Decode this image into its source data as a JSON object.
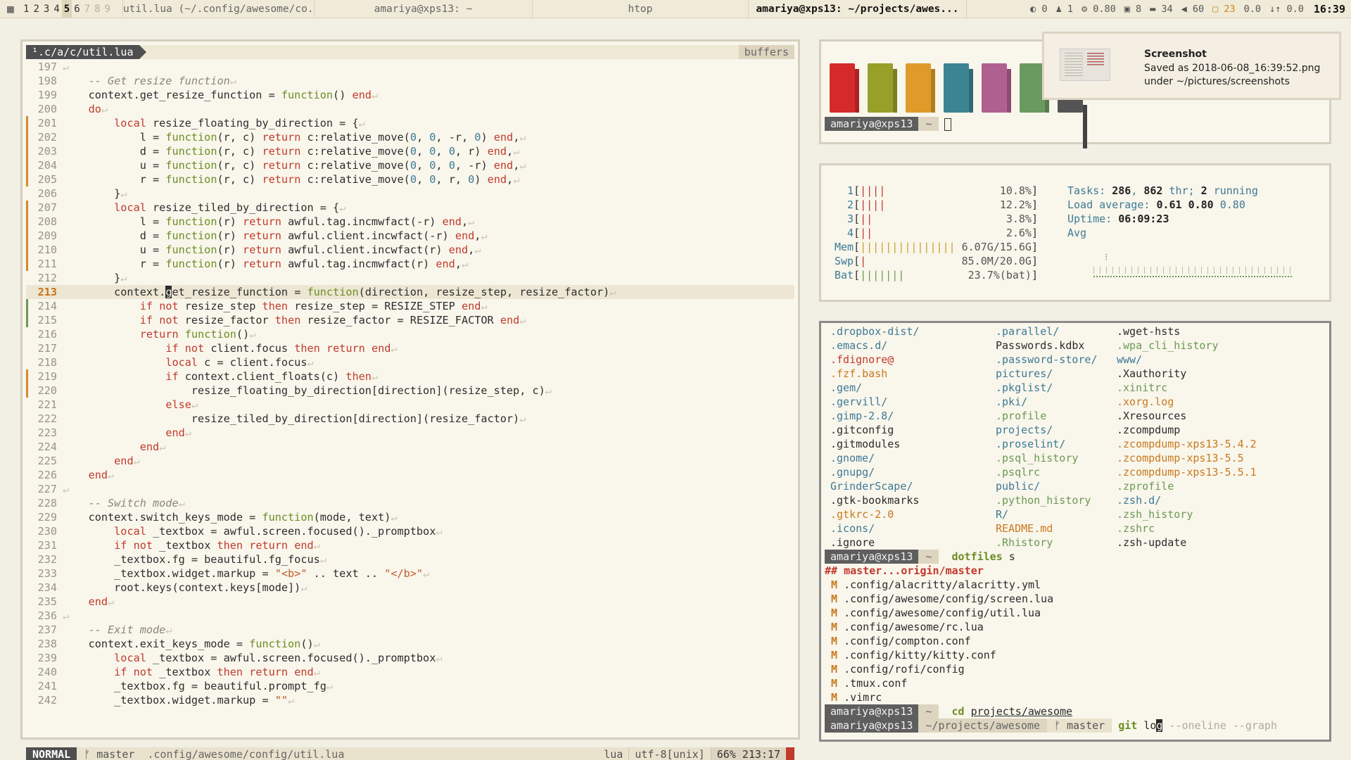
{
  "topbar": {
    "tags": [
      {
        "label": "1",
        "state": "occupied"
      },
      {
        "label": "2",
        "state": "occupied"
      },
      {
        "label": "3",
        "state": "occupied"
      },
      {
        "label": "4",
        "state": "occupied"
      },
      {
        "label": "5",
        "state": "selected"
      },
      {
        "label": "6",
        "state": "occupied"
      },
      {
        "label": "7",
        "state": "empty"
      },
      {
        "label": "8",
        "state": "empty"
      },
      {
        "label": "9",
        "state": "empty"
      }
    ],
    "tasks": [
      {
        "label": "util.lua (~/.config/awesome/co...",
        "focused": false
      },
      {
        "label": "amariya@xps13: ~",
        "focused": false
      },
      {
        "label": "htop",
        "focused": false
      },
      {
        "label": "amariya@xps13: ~/projects/awes...",
        "focused": true
      }
    ],
    "widgets": {
      "w1": "◐ 0",
      "w2": "♟ 1",
      "w3": "⚙ 0.80",
      "w4": "▣ 8",
      "w5": "▬ 34",
      "w6": "◀ 60",
      "w7": "▢ 23",
      "w8": "0.0",
      "w9": "↓↑ 0.0"
    },
    "clock": "16:39"
  },
  "vim": {
    "file_tab": "¹.c/a/c/util.lua",
    "buffers_label": "buffers",
    "status": {
      "mode": "NORMAL",
      "branch": "ᚠ master",
      "path": ".config/awesome/config/util.lua",
      "filetype": "lua",
      "encoding": "utf-8[unix]",
      "position": "66% 213:17"
    }
  },
  "colors_term": {
    "swatches": [
      "#d42a2a",
      "#98a02a",
      "#de9b2a",
      "#3d8493",
      "#b06090",
      "#6b9a60",
      "#545454"
    ],
    "prompt_user": "amariya@xps13",
    "prompt_dir": "~"
  },
  "notification": {
    "title": "Screenshot",
    "body": "Saved as 2018-06-08_16:39:52.png\nunder ~/pictures/screenshots"
  },
  "htop": {
    "cpus": [
      {
        "label": "1",
        "bars": "||||",
        "value": "10.8%"
      },
      {
        "label": "2",
        "bars": "||||",
        "value": "12.2%"
      },
      {
        "label": "3",
        "bars": "||",
        "value": "3.8%"
      },
      {
        "label": "4",
        "bars": "||",
        "value": "2.6%"
      }
    ],
    "mem": {
      "label": "Mem",
      "bars": "|||||||||||||||",
      "value": "6.07G/15.6G"
    },
    "swp": {
      "label": "Swp",
      "bars": "|",
      "value": "85.0M/20.0G"
    },
    "bat": {
      "label": "Bat",
      "bars": "|||||||",
      "value": "23.7%(bat)"
    },
    "tasks_label": "Tasks: ",
    "tasks_count": "286",
    "threads": "862",
    "thr_label": " thr; ",
    "running": "2",
    "running_label": " running",
    "load_label": "Load average: ",
    "load1": "0.61",
    "load5": "0.80",
    "load15": "0.80",
    "uptime_label": "Uptime: ",
    "uptime": "06:09:23",
    "avg_label": "Avg"
  },
  "terminal": {
    "ls_col1": [
      ".dropbox-dist/",
      ".emacs.d/",
      ".fdignore@",
      ".fzf.bash",
      ".gem/",
      ".gervill/",
      ".gimp-2.8/",
      ".gitconfig",
      ".gitmodules",
      ".gnome/",
      ".gnupg/",
      "GrinderScape/",
      ".gtk-bookmarks",
      ".gtkrc-2.0",
      ".icons/",
      ".ignore"
    ],
    "ls_col2": [
      ".parallel/",
      "Passwords.kdbx",
      ".password-store/",
      "pictures/",
      ".pkglist/",
      ".pki/",
      ".profile",
      "projects/",
      ".proselint/",
      ".psql_history",
      ".psqlrc",
      "public/",
      ".python_history",
      "R/",
      "README.md",
      ".Rhistory"
    ],
    "ls_col3": [
      ".wget-hsts",
      ".wpa_cli_history",
      "www/",
      ".Xauthority",
      ".xinitrc",
      ".xorg.log",
      ".Xresources",
      ".zcompdump",
      ".zcompdump-xps13-5.4.2",
      ".zcompdump-xps13-5.5",
      ".zcompdump-xps13-5.5.1",
      ".zprofile",
      ".zsh.d/",
      ".zsh_history",
      ".zshrc",
      ".zsh-update"
    ],
    "prompt_user": "amariya@xps13",
    "prompt_home": "~",
    "cmd1": "dotfiles",
    "cmd1_arg": "s",
    "git_branch_line": "master...origin/master",
    "git_hash": "##",
    "modified_flag": "M",
    "modified_files": [
      ".config/alacritty/alacritty.yml",
      ".config/awesome/config/screen.lua",
      ".config/awesome/config/util.lua",
      ".config/awesome/rc.lua",
      ".config/compton.conf",
      ".config/kitty/kitty.conf",
      ".config/rofi/config",
      ".tmux.conf",
      ".vimrc"
    ],
    "cmd2": "cd",
    "cmd2_arg": "projects/awesome",
    "prompt_dir2": "~/projects/awesome",
    "prompt_branch2": "ᚠ master",
    "cmd3": "git",
    "cmd3_typed": "lo",
    "cmd3_cursor": "g",
    "cmd3_suggest": "--oneline --graph"
  },
  "code_lines": [
    {
      "n": "197",
      "g": "",
      "t": ""
    },
    {
      "n": "198",
      "g": "",
      "t": "    <span class='cm'>-- Get resize function</span>"
    },
    {
      "n": "199",
      "g": "",
      "t": "    context.get_resize_function = <span class='fn'>function</span>() <span class='kw'>end</span>"
    },
    {
      "n": "200",
      "g": "",
      "t": "    <span class='kw'>do</span>"
    },
    {
      "n": "201",
      "g": "mod",
      "t": "        <span class='kw'>local</span> resize_floating_by_direction = {"
    },
    {
      "n": "202",
      "g": "mod",
      "t": "            l = <span class='fn'>function</span>(r, c) <span class='kw'>return</span> c:relative_move(<span class='num'>0</span>, <span class='num'>0</span>, -r, <span class='num'>0</span>) <span class='kw'>end</span>,"
    },
    {
      "n": "203",
      "g": "mod",
      "t": "            d = <span class='fn'>function</span>(r, c) <span class='kw'>return</span> c:relative_move(<span class='num'>0</span>, <span class='num'>0</span>, <span class='num'>0</span>, r) <span class='kw'>end</span>,"
    },
    {
      "n": "204",
      "g": "mod",
      "t": "            u = <span class='fn'>function</span>(r, c) <span class='kw'>return</span> c:relative_move(<span class='num'>0</span>, <span class='num'>0</span>, <span class='num'>0</span>, -r) <span class='kw'>end</span>,"
    },
    {
      "n": "205",
      "g": "mod",
      "t": "            r = <span class='fn'>function</span>(r, c) <span class='kw'>return</span> c:relative_move(<span class='num'>0</span>, <span class='num'>0</span>, r, <span class='num'>0</span>) <span class='kw'>end</span>,"
    },
    {
      "n": "206",
      "g": "",
      "t": "        }"
    },
    {
      "n": "207",
      "g": "mod",
      "t": "        <span class='kw'>local</span> resize_tiled_by_direction = {"
    },
    {
      "n": "208",
      "g": "mod",
      "t": "            l = <span class='fn'>function</span>(r) <span class='kw'>return</span> awful.tag.incmwfact(-r) <span class='kw'>end</span>,"
    },
    {
      "n": "209",
      "g": "mod",
      "t": "            d = <span class='fn'>function</span>(r) <span class='kw'>return</span> awful.client.incwfact(-r) <span class='kw'>end</span>,"
    },
    {
      "n": "210",
      "g": "mod",
      "t": "            u = <span class='fn'>function</span>(r) <span class='kw'>return</span> awful.client.incwfact(r) <span class='kw'>end</span>,"
    },
    {
      "n": "211",
      "g": "mod",
      "t": "            r = <span class='fn'>function</span>(r) <span class='kw'>return</span> awful.tag.incmwfact(r) <span class='kw'>end</span>,"
    },
    {
      "n": "212",
      "g": "",
      "t": "        }"
    },
    {
      "n": "213",
      "g": "",
      "cur": true,
      "t": "        context.<span class='cursor'>g</span>et_resize_function = <span class='fn'>function</span>(direction, resize_step, resize_factor)"
    },
    {
      "n": "214",
      "g": "add",
      "t": "            <span class='kw'>if</span> <span class='kw'>not</span> resize_step <span class='kw'>then</span> resize_step = RESIZE_STEP <span class='kw'>end</span>"
    },
    {
      "n": "215",
      "g": "add",
      "t": "            <span class='kw'>if</span> <span class='kw'>not</span> resize_factor <span class='kw'>then</span> resize_factor = RESIZE_FACTOR <span class='kw'>end</span>"
    },
    {
      "n": "216",
      "g": "",
      "t": "            <span class='kw'>return</span> <span class='fn'>function</span>()"
    },
    {
      "n": "217",
      "g": "",
      "t": "                <span class='kw'>if</span> <span class='kw'>not</span> client.focus <span class='kw'>then</span> <span class='kw'>return</span> <span class='kw'>end</span>"
    },
    {
      "n": "218",
      "g": "",
      "t": "                <span class='kw'>local</span> c = client.focus"
    },
    {
      "n": "219",
      "g": "mod",
      "t": "                <span class='kw'>if</span> context.client_floats(c) <span class='kw'>then</span>"
    },
    {
      "n": "220",
      "g": "mod",
      "t": "                    resize_floating_by_direction[direction](resize_step, c)"
    },
    {
      "n": "221",
      "g": "",
      "t": "                <span class='kw'>else</span>"
    },
    {
      "n": "222",
      "g": "",
      "t": "                    resize_tiled_by_direction[direction](resize_factor)"
    },
    {
      "n": "223",
      "g": "",
      "t": "                <span class='kw'>end</span>"
    },
    {
      "n": "224",
      "g": "",
      "t": "            <span class='kw'>end</span>"
    },
    {
      "n": "225",
      "g": "",
      "t": "        <span class='kw'>end</span>"
    },
    {
      "n": "226",
      "g": "",
      "t": "    <span class='kw'>end</span>"
    },
    {
      "n": "227",
      "g": "",
      "t": ""
    },
    {
      "n": "228",
      "g": "",
      "t": "    <span class='cm'>-- Switch mode</span>"
    },
    {
      "n": "229",
      "g": "",
      "t": "    context.switch_keys_mode = <span class='fn'>function</span>(mode, text)"
    },
    {
      "n": "230",
      "g": "",
      "t": "        <span class='kw'>local</span> _textbox = awful.screen.focused()._promptbox"
    },
    {
      "n": "231",
      "g": "",
      "t": "        <span class='kw'>if</span> <span class='kw'>not</span> _textbox <span class='kw'>then</span> <span class='kw'>return</span> <span class='kw'>end</span>"
    },
    {
      "n": "232",
      "g": "",
      "t": "        _textbox.fg = beautiful.fg_focus"
    },
    {
      "n": "233",
      "g": "",
      "t": "        _textbox.widget.markup = <span class='str'>\"&lt;b&gt;\"</span> .. text .. <span class='str'>\"&lt;/b&gt;\"</span>"
    },
    {
      "n": "234",
      "g": "",
      "t": "        root.keys(context.keys[mode])"
    },
    {
      "n": "235",
      "g": "",
      "t": "    <span class='kw'>end</span>"
    },
    {
      "n": "236",
      "g": "",
      "t": ""
    },
    {
      "n": "237",
      "g": "",
      "t": "    <span class='cm'>-- Exit mode</span>"
    },
    {
      "n": "238",
      "g": "",
      "t": "    context.exit_keys_mode = <span class='fn'>function</span>()"
    },
    {
      "n": "239",
      "g": "",
      "t": "        <span class='kw'>local</span> _textbox = awful.screen.focused()._promptbox"
    },
    {
      "n": "240",
      "g": "",
      "t": "        <span class='kw'>if</span> <span class='kw'>not</span> _textbox <span class='kw'>then</span> <span class='kw'>return</span> <span class='kw'>end</span>"
    },
    {
      "n": "241",
      "g": "",
      "t": "        _textbox.fg = beautiful.prompt_fg"
    },
    {
      "n": "242",
      "g": "",
      "t": "        _textbox.widget.markup = <span class='str'>\"\"</span>"
    }
  ]
}
